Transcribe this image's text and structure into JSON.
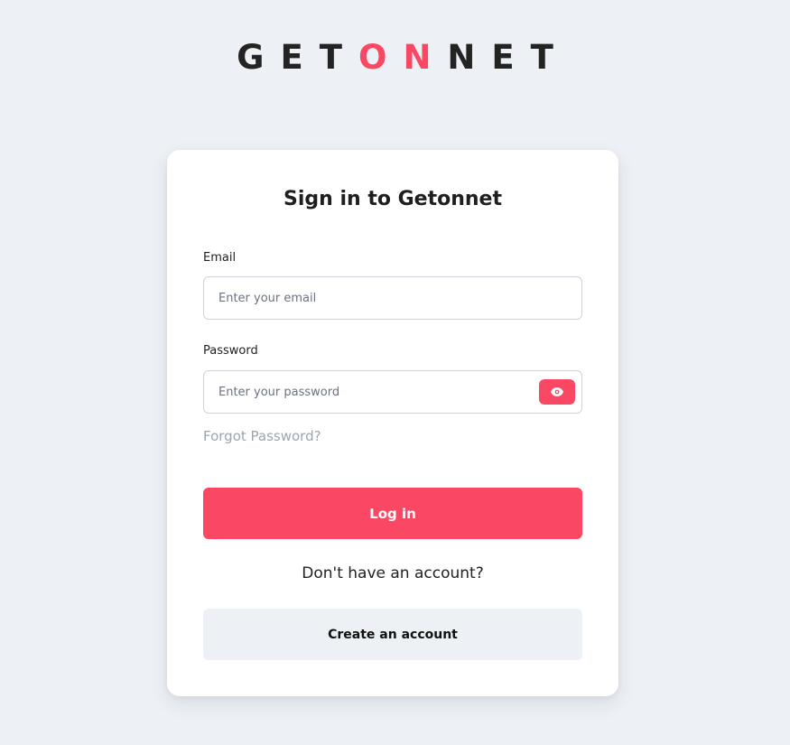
{
  "logo": {
    "part1": "GET",
    "part2": "ON",
    "part3": "NET"
  },
  "form": {
    "title": "Sign in to Getonnet",
    "email_label": "Email",
    "email_placeholder": "Enter your email",
    "email_value": "",
    "password_label": "Password",
    "password_placeholder": "Enter your password",
    "password_value": "",
    "show_password_icon": "eye-icon",
    "forgot_link": "Forgot Password?",
    "login_button": "Log in",
    "no_account_text": "Don't have an account?",
    "create_account_button": "Create an account"
  },
  "colors": {
    "accent": "#f94764",
    "background": "#edf1f5",
    "card": "#ffffff",
    "muted_link": "#9aa5b1"
  }
}
